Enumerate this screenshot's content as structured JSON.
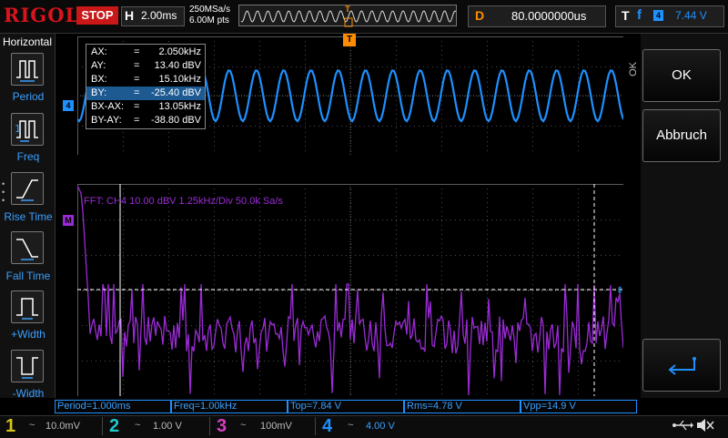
{
  "top": {
    "brand": "RIGOL",
    "status": "STOP",
    "h_label": "H",
    "h_scale": "2.00ms",
    "sample_rate": "250MSa/s",
    "mem_depth": "6.00M pts",
    "trigger_pos_marker": "T",
    "d_label": "D",
    "delay": "80.0000000us",
    "t_label": "T",
    "trig_slope": "f",
    "trig_source": "4",
    "trig_level": "7.44 V"
  },
  "left_menu": {
    "title": "Horizontal",
    "items": [
      {
        "label": "Period",
        "icon": "period-icon"
      },
      {
        "label": "Freq",
        "icon": "freq-icon"
      },
      {
        "label": "Rise Time",
        "icon": "rise-time-icon"
      },
      {
        "label": "Fall Time",
        "icon": "fall-time-icon"
      },
      {
        "label": "+Width",
        "icon": "pos-width-icon"
      },
      {
        "label": "-Width",
        "icon": "neg-width-icon"
      }
    ]
  },
  "cursor": {
    "rows": [
      {
        "name": "AX:",
        "eq": "=",
        "value": "2.050kHz",
        "selected": false
      },
      {
        "name": "AY:",
        "eq": "=",
        "value": "13.40 dBV",
        "selected": false
      },
      {
        "name": "BX:",
        "eq": "=",
        "value": "15.10kHz",
        "selected": false
      },
      {
        "name": "BY:",
        "eq": "=",
        "value": "-25.40 dBV",
        "selected": true
      },
      {
        "name": "BX-AX:",
        "eq": "=",
        "value": "13.05kHz",
        "selected": false
      },
      {
        "name": "BY-AY:",
        "eq": "=",
        "value": "-38.80 dBV",
        "selected": false
      }
    ]
  },
  "markers": {
    "ch4": "4",
    "math": "M"
  },
  "fft_label": "FFT: CH4  10.00 dBV   1.25kHz/Div    50.0k Sa/s",
  "right_menu": {
    "ok_side": "OK",
    "ok": "OK",
    "cancel": "Abbruch",
    "back_icon": "return-arrow-icon"
  },
  "measurements": [
    "Period=1.000ms",
    "Freq=1.00kHz",
    "Top=7.84 V",
    "Rms=4.78 V",
    "Vpp=14.9 V"
  ],
  "channels": [
    {
      "num": "1",
      "coupling": "~",
      "scale": "10.0mV",
      "color": "#d4c21a"
    },
    {
      "num": "2",
      "coupling": "~",
      "scale": "1.00 V",
      "color": "#1ec8c8"
    },
    {
      "num": "3",
      "coupling": "~",
      "scale": "100mV",
      "color": "#d63fbf"
    },
    {
      "num": "4",
      "coupling": "~",
      "scale": "4.00 V",
      "color": "#1e90ff"
    }
  ],
  "colors": {
    "ch4": "#1e90ff",
    "math": "#9b2bd6",
    "trigger": "#ff8c00",
    "brand": "#d8141c"
  },
  "status_icons": [
    "usb-icon",
    "speaker-muted-icon"
  ]
}
